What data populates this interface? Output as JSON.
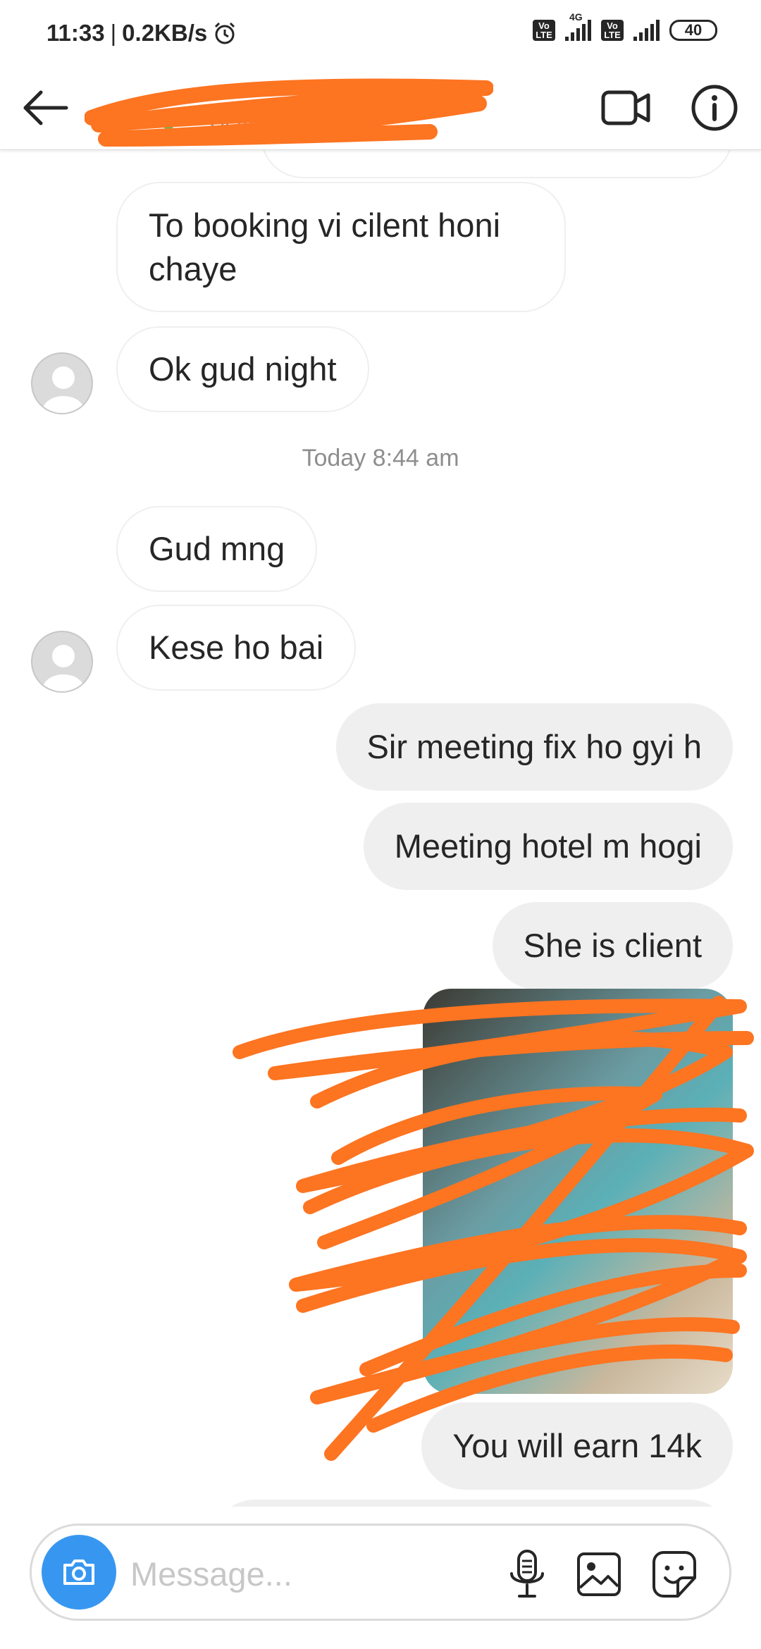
{
  "status_bar": {
    "time": "11:33",
    "speed": "0.2KB/s",
    "network_type": "4G",
    "volte_label": "Vo\nLTE",
    "battery": "40",
    "icons": [
      "alarm-icon",
      "signal-icon",
      "battery-icon"
    ]
  },
  "header": {
    "contact_name": "",
    "subtitle": "Active now",
    "icons": [
      "back-arrow-icon",
      "video-call-icon",
      "info-icon"
    ]
  },
  "messages": [
    {
      "direction": "incoming",
      "text_line1": "To booking vi cilent honi",
      "text_line2": "chaye"
    },
    {
      "direction": "incoming",
      "text": "Ok gud night",
      "avatar": true
    },
    {
      "type": "timestamp",
      "text": "Today 8:44 am"
    },
    {
      "direction": "incoming",
      "text": "Gud mng"
    },
    {
      "direction": "incoming",
      "text": "Kese ho bai",
      "avatar": true
    },
    {
      "direction": "outgoing",
      "text": "Sir meeting fix ho gyi h"
    },
    {
      "direction": "outgoing",
      "text": "Meeting hotel m hogi"
    },
    {
      "direction": "outgoing",
      "text": "She is client"
    },
    {
      "direction": "outgoing",
      "type": "image"
    },
    {
      "direction": "outgoing",
      "text": "You will earn 14k"
    }
  ],
  "composer": {
    "placeholder": "Message...",
    "icons": [
      "camera-icon",
      "microphone-icon",
      "gallery-icon",
      "sticker-icon"
    ]
  },
  "colors": {
    "accent_blue": "#3797f0",
    "outgoing_bubble": "#efefef",
    "redaction_orange": "#fd7421",
    "online_green": "#44c553"
  }
}
